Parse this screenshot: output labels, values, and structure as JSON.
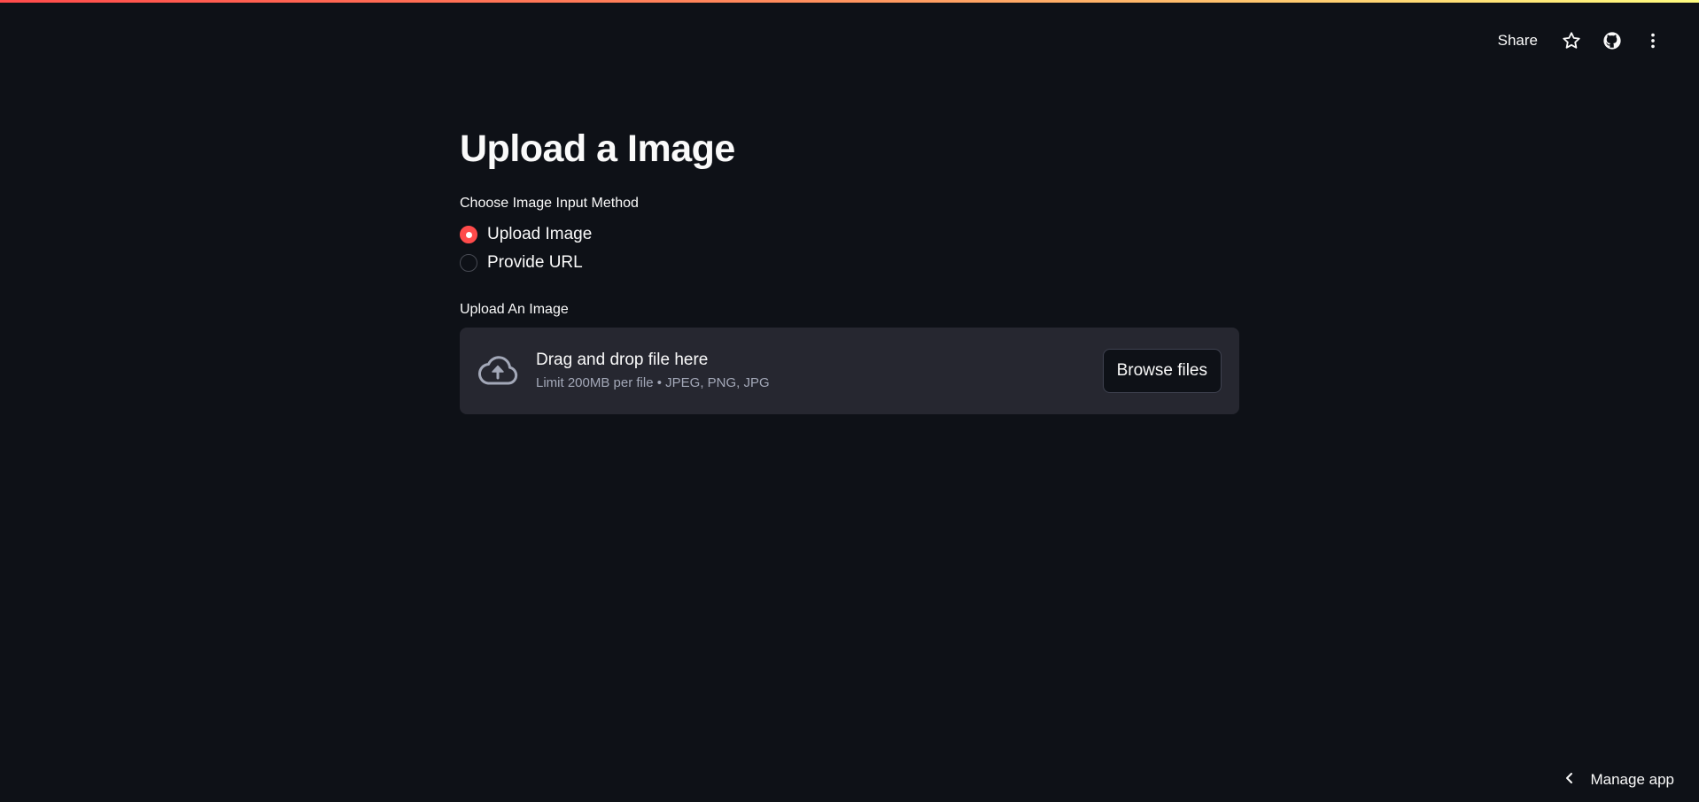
{
  "header": {
    "share_label": "Share"
  },
  "icons": {
    "star": "star-icon",
    "github": "github-icon",
    "menu": "kebab-menu-icon",
    "upload": "cloud-upload-icon",
    "chevron": "chevron-left-icon"
  },
  "colors": {
    "background": "#0e1117",
    "accent": "#ff4b4b",
    "dropzone": "#262730",
    "muted_text": "#a3a8b8"
  },
  "main": {
    "title": "Upload a Image",
    "radio": {
      "label": "Choose Image Input Method",
      "selected": "Upload Image",
      "options": [
        {
          "label": "Upload Image",
          "checked": true
        },
        {
          "label": "Provide URL",
          "checked": false
        }
      ]
    },
    "uploader": {
      "label": "Upload An Image",
      "drop_text": "Drag and drop file here",
      "limit_text": "Limit 200MB per file • JPEG, PNG, JPG",
      "browse_label": "Browse files"
    }
  },
  "footer": {
    "manage_label": "Manage app"
  }
}
